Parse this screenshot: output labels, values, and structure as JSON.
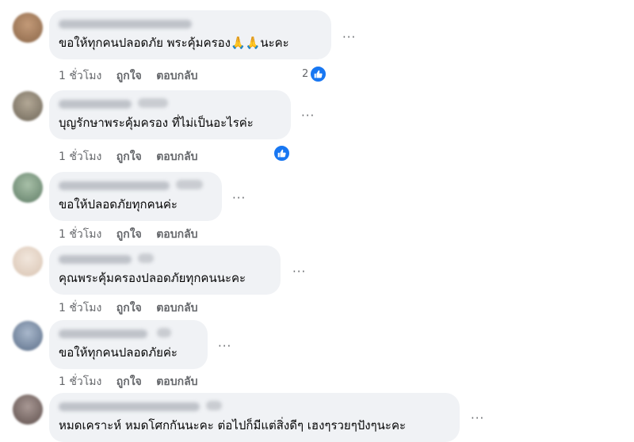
{
  "comments": [
    {
      "text": "ขอให้ทุกคนปลอดภัย พระคุ้มครอง🙏🙏นะคะ",
      "time": "1 ชั่วโมง",
      "like": "ถูกใจ",
      "reply": "ตอบกลับ",
      "reaction_count": "2",
      "avatar_color": "#a07a5c"
    },
    {
      "text": "บุญรักษาพระคุ้มครอง ที่ไม่เป็นอะไรค่ะ",
      "time": "1 ชั่วโมง",
      "like": "ถูกใจ",
      "reply": "ตอบกลับ",
      "reaction_count": "",
      "avatar_color": "#8f8676"
    },
    {
      "text": "ขอให้ปลอดภัยทุกคนค่ะ",
      "time": "1 ชั่วโมง",
      "like": "ถูกใจ",
      "reply": "ตอบกลับ",
      "reaction_count": "",
      "avatar_color": "#7f9a86"
    },
    {
      "text": "คุณพระคุ้มครองปลอดภัยทุกคนนะคะ",
      "time": "1 ชั่วโมง",
      "like": "ถูกใจ",
      "reply": "ตอบกลับ",
      "reaction_count": "",
      "avatar_color": "#e8d7c8"
    },
    {
      "text": "ขอให้ทุกคนปลอดภัยค่ะ",
      "time": "1 ชั่วโมง",
      "like": "ถูกใจ",
      "reply": "ตอบกลับ",
      "reaction_count": "",
      "avatar_color": "#7b8fa8"
    },
    {
      "text": "หมดเคราะห์ หมดโศกกันนะคะ ต่อไปก็มีแต่สิ่งดีๆ เฮงๆรวยๆปังๆนะคะ",
      "time": "",
      "like": "",
      "reply": "",
      "reaction_count": "",
      "avatar_color": "#7a6a66"
    }
  ],
  "ui": {
    "more_label": "···",
    "like_icon": "thumbs-up-icon",
    "accent": "#1877f2"
  }
}
